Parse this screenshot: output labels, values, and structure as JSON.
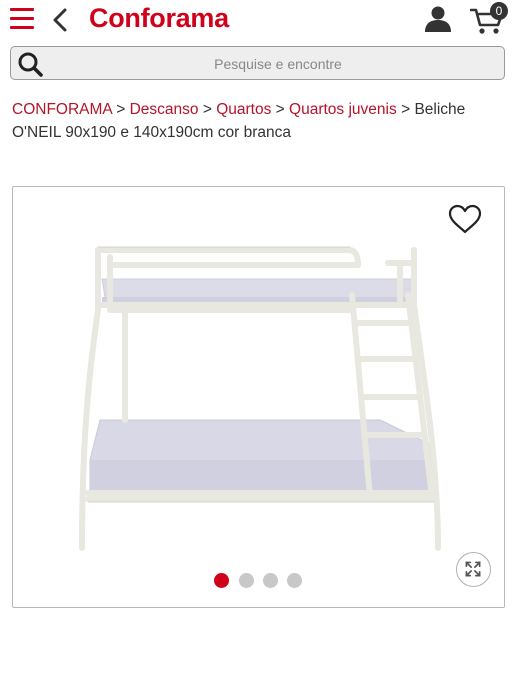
{
  "header": {
    "logo_text": "Conforama",
    "cart_count": "0",
    "brand_color": "#d0021b",
    "icons": [
      "menu-icon",
      "back-chevron-icon",
      "user-icon",
      "cart-icon"
    ]
  },
  "search": {
    "placeholder": "Pesquise e encontre",
    "icon": "search-icon"
  },
  "breadcrumb": {
    "links": [
      "CONFORAMA",
      "Descanso",
      "Quartos",
      "Quartos juvenis"
    ],
    "separator": ">",
    "current": "Beliche O'NEIL 90x190 e 140x190cm cor branca"
  },
  "product": {
    "image_alt_icon": "bunk-bed-image",
    "wishlist_icon": "heart-icon",
    "zoom_icon": "expand-icon",
    "carousel": {
      "total": 4,
      "active_index": 0,
      "active_color": "#d0021b",
      "inactive_color": "#c8c8c8"
    }
  }
}
